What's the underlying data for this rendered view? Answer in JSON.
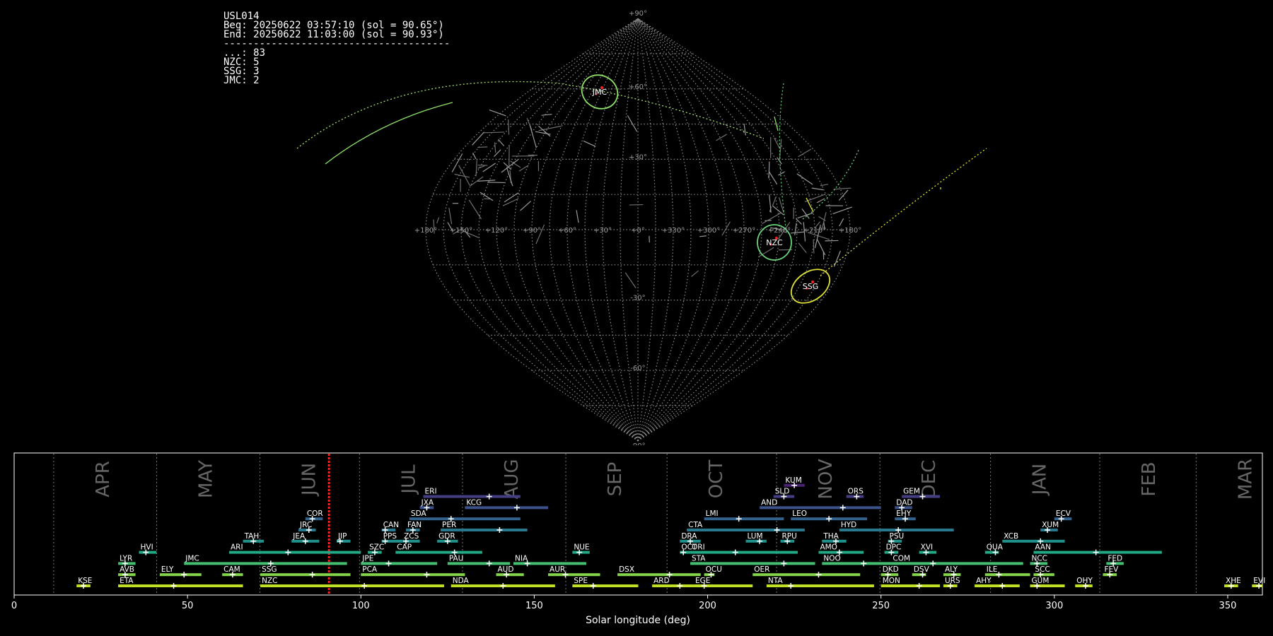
{
  "info": {
    "station": "USL014",
    "begin": "Beg: 20250622 03:57:10 (sol = 90.65°)",
    "end": "End: 20250622 11:03:00 (sol = 90.93°)",
    "separator": "--------------------------------------",
    "counts": [
      {
        "code": "...",
        "count": 83
      },
      {
        "code": "NZC",
        "count": 5
      },
      {
        "code": "SSG",
        "count": 3
      },
      {
        "code": "JMC",
        "count": 2
      }
    ]
  },
  "chart_data": [
    {
      "type": "scatter",
      "projection": "sinusoidal-like all-sky map",
      "grid": true,
      "lon_ticks": [
        "+180°",
        "+150°",
        "+120°",
        "+90°",
        "+60°",
        "+30°",
        "+0°",
        "+330°",
        "+300°",
        "+270°",
        "+240°",
        "+210°",
        "+180°"
      ],
      "lat_ticks": [
        "+90°",
        "+60°",
        "+30°",
        "-30°",
        "-60°",
        "-90°"
      ],
      "radiants": [
        {
          "name": "JMC",
          "color": "#8ee06a"
        },
        {
          "name": "NZC",
          "color": "#6ad27a"
        },
        {
          "name": "SSG",
          "color": "#e0e03a"
        }
      ]
    },
    {
      "type": "timeline",
      "xlabel": "Solar longitude (deg)",
      "xlim": [
        0,
        360
      ],
      "x_ticks": [
        0,
        50,
        100,
        150,
        200,
        250,
        300,
        350
      ],
      "current_sol": 90.8,
      "months": [
        {
          "label": "APR",
          "start": 11.4
        },
        {
          "label": "MAY",
          "start": 41.1
        },
        {
          "label": "JUN",
          "start": 70.9
        },
        {
          "label": "JUL",
          "start": 99.6
        },
        {
          "label": "AUG",
          "start": 129.3
        },
        {
          "label": "SEP",
          "start": 159.1
        },
        {
          "label": "OCT",
          "start": 188.3
        },
        {
          "label": "NOV",
          "start": 219.9
        },
        {
          "label": "DEC",
          "start": 249.7
        },
        {
          "label": "JAN",
          "start": 281.6
        },
        {
          "label": "FEB",
          "start": 313.1
        },
        {
          "label": "MAR",
          "start": 340.9
        }
      ],
      "showers": [
        {
          "code": "KUM",
          "start": 222,
          "end": 228,
          "peak": 225,
          "row": 9
        },
        {
          "code": "ERI",
          "start": 118,
          "end": 146,
          "peak": 137,
          "row": 8
        },
        {
          "code": "SLD",
          "start": 219,
          "end": 225,
          "peak": 222,
          "row": 8
        },
        {
          "code": "ORS",
          "start": 240,
          "end": 245,
          "peak": 243,
          "row": 8
        },
        {
          "code": "GEM",
          "start": 256,
          "end": 267,
          "peak": 262,
          "row": 8
        },
        {
          "code": "JXA",
          "start": 117,
          "end": 121,
          "peak": 119,
          "row": 7
        },
        {
          "code": "KCG",
          "start": 130,
          "end": 154,
          "peak": 145,
          "row": 7
        },
        {
          "code": "AND",
          "start": 215,
          "end": 250,
          "peak": 239,
          "row": 7
        },
        {
          "code": "DAD",
          "start": 254,
          "end": 259,
          "peak": 256,
          "row": 7
        },
        {
          "code": "COR",
          "start": 84,
          "end": 89,
          "peak": 86,
          "row": 6
        },
        {
          "code": "SDA",
          "start": 114,
          "end": 146,
          "peak": 126,
          "row": 6
        },
        {
          "code": "LMI",
          "start": 199,
          "end": 222,
          "peak": 209,
          "row": 6
        },
        {
          "code": "LEO",
          "start": 224,
          "end": 246,
          "peak": 235,
          "row": 6
        },
        {
          "code": "EHY",
          "start": 254,
          "end": 260,
          "peak": 257,
          "row": 6
        },
        {
          "code": "ECV",
          "start": 300,
          "end": 305,
          "peak": 302,
          "row": 6
        },
        {
          "code": "JRC",
          "start": 82,
          "end": 87,
          "peak": 85,
          "row": 5
        },
        {
          "code": "CAN",
          "start": 106,
          "end": 110,
          "peak": 107,
          "row": 5
        },
        {
          "code": "FAN",
          "start": 113,
          "end": 117,
          "peak": 115,
          "row": 5
        },
        {
          "code": "PER",
          "start": 123,
          "end": 148,
          "peak": 140,
          "row": 5
        },
        {
          "code": "CTA",
          "start": 194,
          "end": 228,
          "peak": 220,
          "row": 5
        },
        {
          "code": "HYD",
          "start": 238,
          "end": 271,
          "peak": 255,
          "row": 5
        },
        {
          "code": "XUM",
          "start": 296,
          "end": 301,
          "peak": 298,
          "row": 5
        },
        {
          "code": "TAH",
          "start": 66,
          "end": 72,
          "peak": 69,
          "row": 4
        },
        {
          "code": "JEA",
          "start": 80,
          "end": 88,
          "peak": 84,
          "row": 4
        },
        {
          "code": "JIP",
          "start": 93,
          "end": 97,
          "peak": 94,
          "row": 4
        },
        {
          "code": "PPS",
          "start": 106,
          "end": 112,
          "peak": 107,
          "row": 4
        },
        {
          "code": "ZCS",
          "start": 112,
          "end": 117,
          "peak": 113,
          "row": 4
        },
        {
          "code": "GDR",
          "start": 122,
          "end": 128,
          "peak": 125,
          "row": 4
        },
        {
          "code": "DRA",
          "start": 192,
          "end": 198,
          "peak": 195,
          "row": 4
        },
        {
          "code": "LUM",
          "start": 211,
          "end": 217,
          "peak": 215,
          "row": 4
        },
        {
          "code": "RPU",
          "start": 221,
          "end": 225,
          "peak": 223,
          "row": 4
        },
        {
          "code": "THA",
          "start": 233,
          "end": 240,
          "peak": 237,
          "row": 4
        },
        {
          "code": "PSU",
          "start": 252,
          "end": 256,
          "peak": 253,
          "row": 4
        },
        {
          "code": "XCB",
          "start": 285,
          "end": 303,
          "peak": 296,
          "row": 4
        },
        {
          "code": "HVI",
          "start": 36,
          "end": 41,
          "peak": 38,
          "row": 3
        },
        {
          "code": "ARI",
          "start": 62,
          "end": 100,
          "peak": 79,
          "row": 3
        },
        {
          "code": "SZC",
          "start": 102,
          "end": 106,
          "peak": 104,
          "row": 3
        },
        {
          "code": "CAP",
          "start": 110,
          "end": 135,
          "peak": 127,
          "row": 3
        },
        {
          "code": "NUE",
          "start": 161,
          "end": 166,
          "peak": 163,
          "row": 3
        },
        {
          "code": "OCT",
          "start": 192,
          "end": 195,
          "peak": 193,
          "row": 3
        },
        {
          "code": "ORI",
          "start": 195,
          "end": 226,
          "peak": 208,
          "row": 3
        },
        {
          "code": "AMO",
          "start": 232,
          "end": 245,
          "peak": 238,
          "row": 3
        },
        {
          "code": "DPC",
          "start": 251,
          "end": 255,
          "peak": 253,
          "row": 3
        },
        {
          "code": "XVI",
          "start": 261,
          "end": 266,
          "peak": 263,
          "row": 3
        },
        {
          "code": "QUA",
          "start": 280,
          "end": 284,
          "peak": 283,
          "row": 3
        },
        {
          "code": "AAN",
          "start": 294,
          "end": 331,
          "peak": 312,
          "row": 3
        },
        {
          "code": "LYR",
          "start": 30,
          "end": 35,
          "peak": 32,
          "row": 2
        },
        {
          "code": "JMC",
          "start": 49,
          "end": 96,
          "peak": 74,
          "row": 2
        },
        {
          "code": "JPE",
          "start": 100,
          "end": 122,
          "peak": 108,
          "row": 2
        },
        {
          "code": "PAU",
          "start": 125,
          "end": 143,
          "peak": 137,
          "row": 2
        },
        {
          "code": "NIA",
          "start": 144,
          "end": 165,
          "peak": 148,
          "row": 2
        },
        {
          "code": "STA",
          "start": 195,
          "end": 231,
          "peak": 222,
          "row": 2
        },
        {
          "code": "NOO",
          "start": 233,
          "end": 253,
          "peak": 245,
          "row": 2
        },
        {
          "code": "COM",
          "start": 253,
          "end": 291,
          "peak": 265,
          "row": 2
        },
        {
          "code": "NCC",
          "start": 293,
          "end": 298,
          "peak": 295,
          "row": 2
        },
        {
          "code": "FED",
          "start": 315,
          "end": 320,
          "peak": 317,
          "row": 2
        },
        {
          "code": "AVB",
          "start": 30,
          "end": 35,
          "peak": 32,
          "row": 1
        },
        {
          "code": "ELY",
          "start": 42,
          "end": 54,
          "peak": 49,
          "row": 1
        },
        {
          "code": "CAM",
          "start": 60,
          "end": 66,
          "peak": 63,
          "row": 1
        },
        {
          "code": "SSG",
          "start": 71,
          "end": 97,
          "peak": 86,
          "row": 1
        },
        {
          "code": "PCA",
          "start": 100,
          "end": 130,
          "peak": 119,
          "row": 1
        },
        {
          "code": "AUD",
          "start": 139,
          "end": 147,
          "peak": 142,
          "row": 1
        },
        {
          "code": "AUR",
          "start": 154,
          "end": 169,
          "peak": 159,
          "row": 1
        },
        {
          "code": "DSX",
          "start": 174,
          "end": 198,
          "peak": 189,
          "row": 1
        },
        {
          "code": "OCU",
          "start": 199,
          "end": 202,
          "peak": 201,
          "row": 1
        },
        {
          "code": "OER",
          "start": 213,
          "end": 244,
          "peak": 232,
          "row": 1
        },
        {
          "code": "DKD",
          "start": 250,
          "end": 255,
          "peak": 252,
          "row": 1
        },
        {
          "code": "DSV",
          "start": 259,
          "end": 263,
          "peak": 262,
          "row": 1
        },
        {
          "code": "ALY",
          "start": 268,
          "end": 273,
          "peak": 271,
          "row": 1
        },
        {
          "code": "ILE",
          "start": 280,
          "end": 293,
          "peak": 284,
          "row": 1
        },
        {
          "code": "SCC",
          "start": 294,
          "end": 300,
          "peak": 296,
          "row": 1
        },
        {
          "code": "FEV",
          "start": 314,
          "end": 318,
          "peak": 316,
          "row": 1
        },
        {
          "code": "KSE",
          "start": 18,
          "end": 22,
          "peak": 20,
          "row": 0
        },
        {
          "code": "ETA",
          "start": 30,
          "end": 66,
          "peak": 46,
          "row": 0
        },
        {
          "code": "NZC",
          "start": 71,
          "end": 124,
          "peak": 101,
          "row": 0
        },
        {
          "code": "NDA",
          "start": 126,
          "end": 156,
          "peak": 141,
          "row": 0
        },
        {
          "code": "SPE",
          "start": 161,
          "end": 180,
          "peak": 167,
          "row": 0
        },
        {
          "code": "ARD",
          "start": 184,
          "end": 196,
          "peak": 192,
          "row": 0
        },
        {
          "code": "EGE",
          "start": 196,
          "end": 213,
          "peak": 199,
          "row": 0
        },
        {
          "code": "NTA",
          "start": 217,
          "end": 248,
          "peak": 224,
          "row": 0
        },
        {
          "code": "MON",
          "start": 250,
          "end": 267,
          "peak": 261,
          "row": 0
        },
        {
          "code": "URS",
          "start": 268,
          "end": 272,
          "peak": 270,
          "row": 0
        },
        {
          "code": "AHY",
          "start": 277,
          "end": 290,
          "peak": 285,
          "row": 0
        },
        {
          "code": "GUM",
          "start": 293,
          "end": 303,
          "peak": 295,
          "row": 0
        },
        {
          "code": "OHY",
          "start": 306,
          "end": 311,
          "peak": 309,
          "row": 0
        },
        {
          "code": "XHE",
          "start": 349,
          "end": 353,
          "peak": 351,
          "row": 0
        },
        {
          "code": "EVI",
          "start": 357,
          "end": 360,
          "peak": 359,
          "row": 0
        }
      ]
    }
  ]
}
